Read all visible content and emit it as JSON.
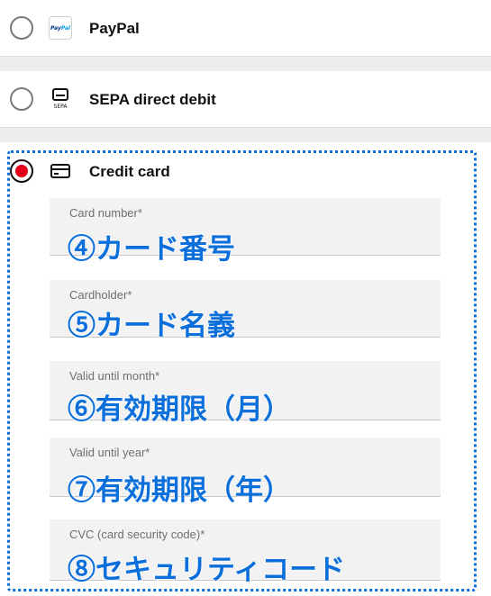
{
  "payment_methods": [
    {
      "label": "PayPal",
      "icon": "paypal-icon",
      "icon_text_1": "Pay",
      "icon_text_2": "Pal",
      "selected": false
    },
    {
      "label": "SEPA direct debit",
      "icon": "sepa-card-icon",
      "icon_text": "SEPA",
      "selected": false
    },
    {
      "label": "Credit card",
      "icon": "credit-card-icon",
      "selected": true
    }
  ],
  "credit_card_fields": [
    {
      "label": "Card number*",
      "annotation": "④カード番号"
    },
    {
      "label": "Cardholder*",
      "annotation": "⑤カード名義"
    },
    {
      "label": "Valid until month*",
      "annotation": "⑥有効期限（月）"
    },
    {
      "label": "Valid until year*",
      "annotation": "⑦有効期限（年）"
    },
    {
      "label": "CVC (card security code)*",
      "annotation": "⑧セキュリティコード"
    }
  ],
  "colors": {
    "radio_selected": "#e1001a",
    "annotation": "#0a6edb",
    "field_bg": "#f2f2f2",
    "separator_bg": "#eeeeee"
  }
}
